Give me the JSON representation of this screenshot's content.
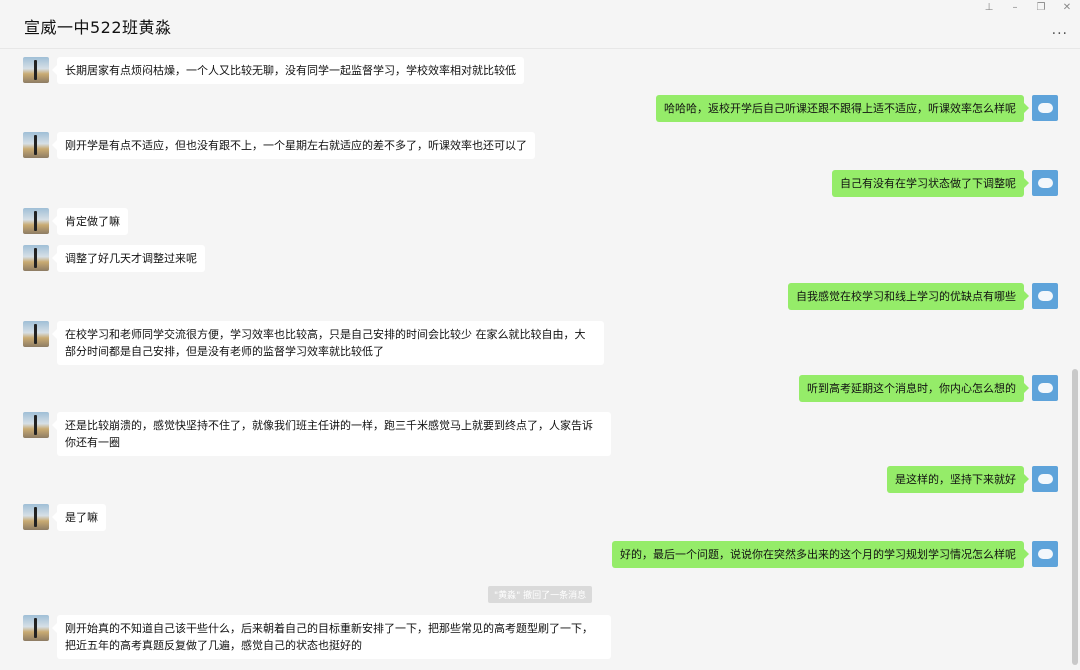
{
  "window": {
    "title": "宣威一中522班黄淼",
    "pin_icon": "pin-icon",
    "minimize_icon": "minimize-icon",
    "restore_icon": "restore-icon",
    "close_icon": "close-icon",
    "more_label": "..."
  },
  "messages": [
    {
      "side": "left",
      "text": "长期居家有点烦闷枯燥，一个人又比较无聊，没有同学一起监督学习，学校效率相对就比较低"
    },
    {
      "side": "right",
      "text": "哈哈哈，返校开学后自己听课还跟不跟得上适不适应，听课效率怎么样呢"
    },
    {
      "side": "left",
      "text": "刚开学是有点不适应，但也没有跟不上，一个星期左右就适应的差不多了，听课效率也还可以了"
    },
    {
      "side": "right",
      "text": "自己有没有在学习状态做了下调整呢"
    },
    {
      "side": "left",
      "text": "肯定做了嘛"
    },
    {
      "side": "left",
      "text": "调整了好几天才调整过来呢"
    },
    {
      "side": "right",
      "text": "自我感觉在校学习和线上学习的优缺点有哪些"
    },
    {
      "side": "left",
      "text": "在校学习和老师同学交流很方便，学习效率也比较高，只是自己安排的时间会比较少 在家么就比较自由，大部分时间都是自己安排，但是没有老师的监督学习效率就比较低了"
    },
    {
      "side": "right",
      "text": "听到高考延期这个消息时，你内心怎么想的"
    },
    {
      "side": "left",
      "text": "还是比较崩溃的，感觉快坚持不住了，就像我们班主任讲的一样，跑三千米感觉马上就要到终点了，人家告诉你还有一圈"
    },
    {
      "side": "right",
      "text": "是这样的，坚持下来就好"
    },
    {
      "side": "left",
      "text": "是了嘛"
    },
    {
      "side": "right",
      "text": "好的，最后一个问题，说说你在突然多出来的这个月的学习规划学习情况怎么样呢"
    },
    {
      "side": "left",
      "text": "刚开始真的不知道自己该干些什么，后来朝着自己的目标重新安排了一下，把那些常见的高考题型刷了一下，把近五年的高考真题反复做了几遍，感觉自己的状态也挺好的"
    }
  ],
  "recall_notice": "\"黄淼\" 撤回了一条消息",
  "avatars": {
    "left": "contact-avatar",
    "right": "self-avatar"
  },
  "colors": {
    "self_bubble": "#95ec69",
    "other_bubble": "#ffffff",
    "background": "#f5f5f5"
  }
}
